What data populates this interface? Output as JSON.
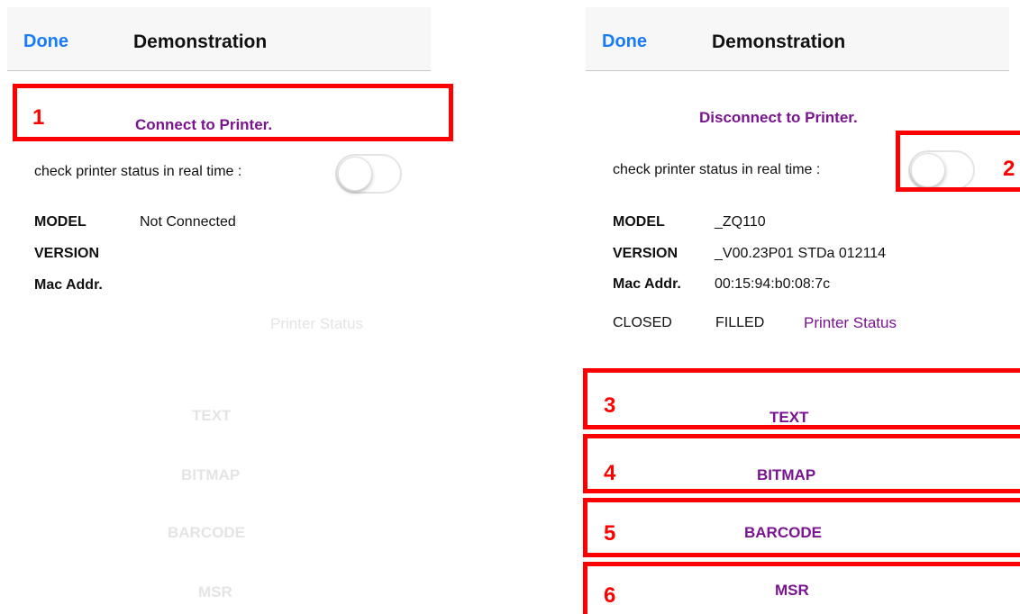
{
  "left": {
    "nav": {
      "done": "Done",
      "title": "Demonstration"
    },
    "connect_label": "Connect to Printer.",
    "check_label": "check printer status in real time :",
    "info": {
      "model_key": "MODEL",
      "model_val": "Not Connected",
      "version_key": "VERSION",
      "mac_key": "Mac Addr."
    },
    "printer_status": "Printer Status",
    "buttons": {
      "text": "TEXT",
      "bitmap": "BITMAP",
      "barcode": "BARCODE",
      "msr": "MSR"
    },
    "toggle_on": false
  },
  "right": {
    "nav": {
      "done": "Done",
      "title": "Demonstration"
    },
    "connect_label": "Disconnect to Printer.",
    "check_label": "check printer status in real time :",
    "info": {
      "model_key": "MODEL",
      "model_val": "_ZQ110",
      "version_key": "VERSION",
      "version_val": "_V00.23P01 STDa 012114",
      "mac_key": "Mac Addr.",
      "mac_val": "00:15:94:b0:08:7c"
    },
    "status": {
      "cover": "CLOSED",
      "paper": "FILLED",
      "link": "Printer Status"
    },
    "buttons": {
      "text": "TEXT",
      "bitmap": "BITMAP",
      "barcode": "BARCODE",
      "msr": "MSR"
    },
    "toggle_on": false
  },
  "annotations": [
    "1",
    "2",
    "3",
    "4",
    "5",
    "6"
  ],
  "colors": {
    "accent_blue": "#1a7cf5",
    "purple": "#7a1490",
    "disabled_gray": "#e4e4e4",
    "annotation_red": "#ff0000"
  }
}
